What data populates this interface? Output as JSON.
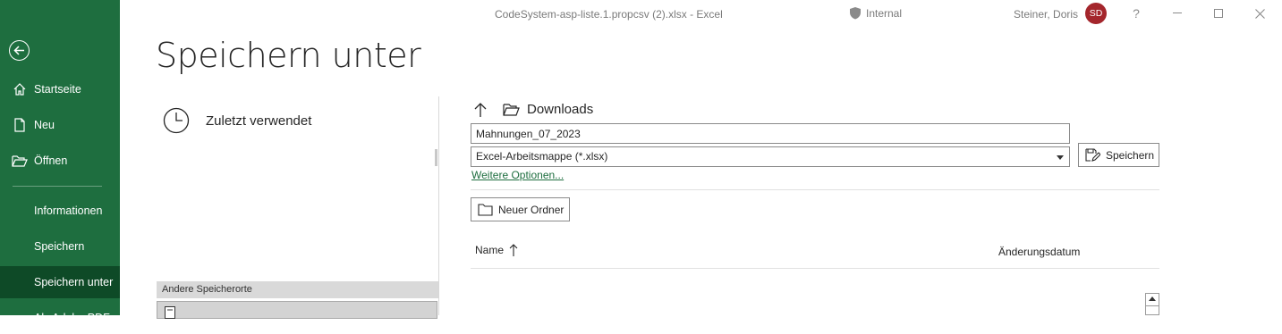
{
  "titlebar": {
    "title": "CodeSystem-asp-liste.1.propcsv (2).xlsx  -  Excel",
    "sensitivity": "Internal",
    "user_name": "Steiner, Doris",
    "avatar_initials": "SD",
    "help": "?",
    "minimize": "—",
    "maximize": "☐",
    "close": "✕"
  },
  "sidebar": {
    "items": [
      {
        "label": "Startseite",
        "icon": "home-icon"
      },
      {
        "label": "Neu",
        "icon": "new-document-icon"
      },
      {
        "label": "Öffnen",
        "icon": "open-folder-icon"
      },
      {
        "label": "Informationen"
      },
      {
        "label": "Speichern"
      },
      {
        "label": "Speichern unter",
        "active": true
      },
      {
        "label": "Als Adobe PDF"
      }
    ]
  },
  "main": {
    "page_title": "Speichern unter",
    "recent_label": "Zuletzt verwendet",
    "other_locations_label": "Andere Speicherorte"
  },
  "browser": {
    "current_folder": "Downloads",
    "filename": "Mahnungen_07_2023",
    "filetype": "Excel-Arbeitsmappe (*.xlsx)",
    "more_options": "Weitere Optionen...",
    "save_label": "Speichern",
    "new_folder_label": "Neuer Ordner",
    "columns": {
      "name": "Name",
      "date": "Änderungsdatum"
    }
  },
  "colors": {
    "accent": "#1e6e3f",
    "accent_dark": "#0e4a27",
    "avatar": "#a4262c"
  }
}
